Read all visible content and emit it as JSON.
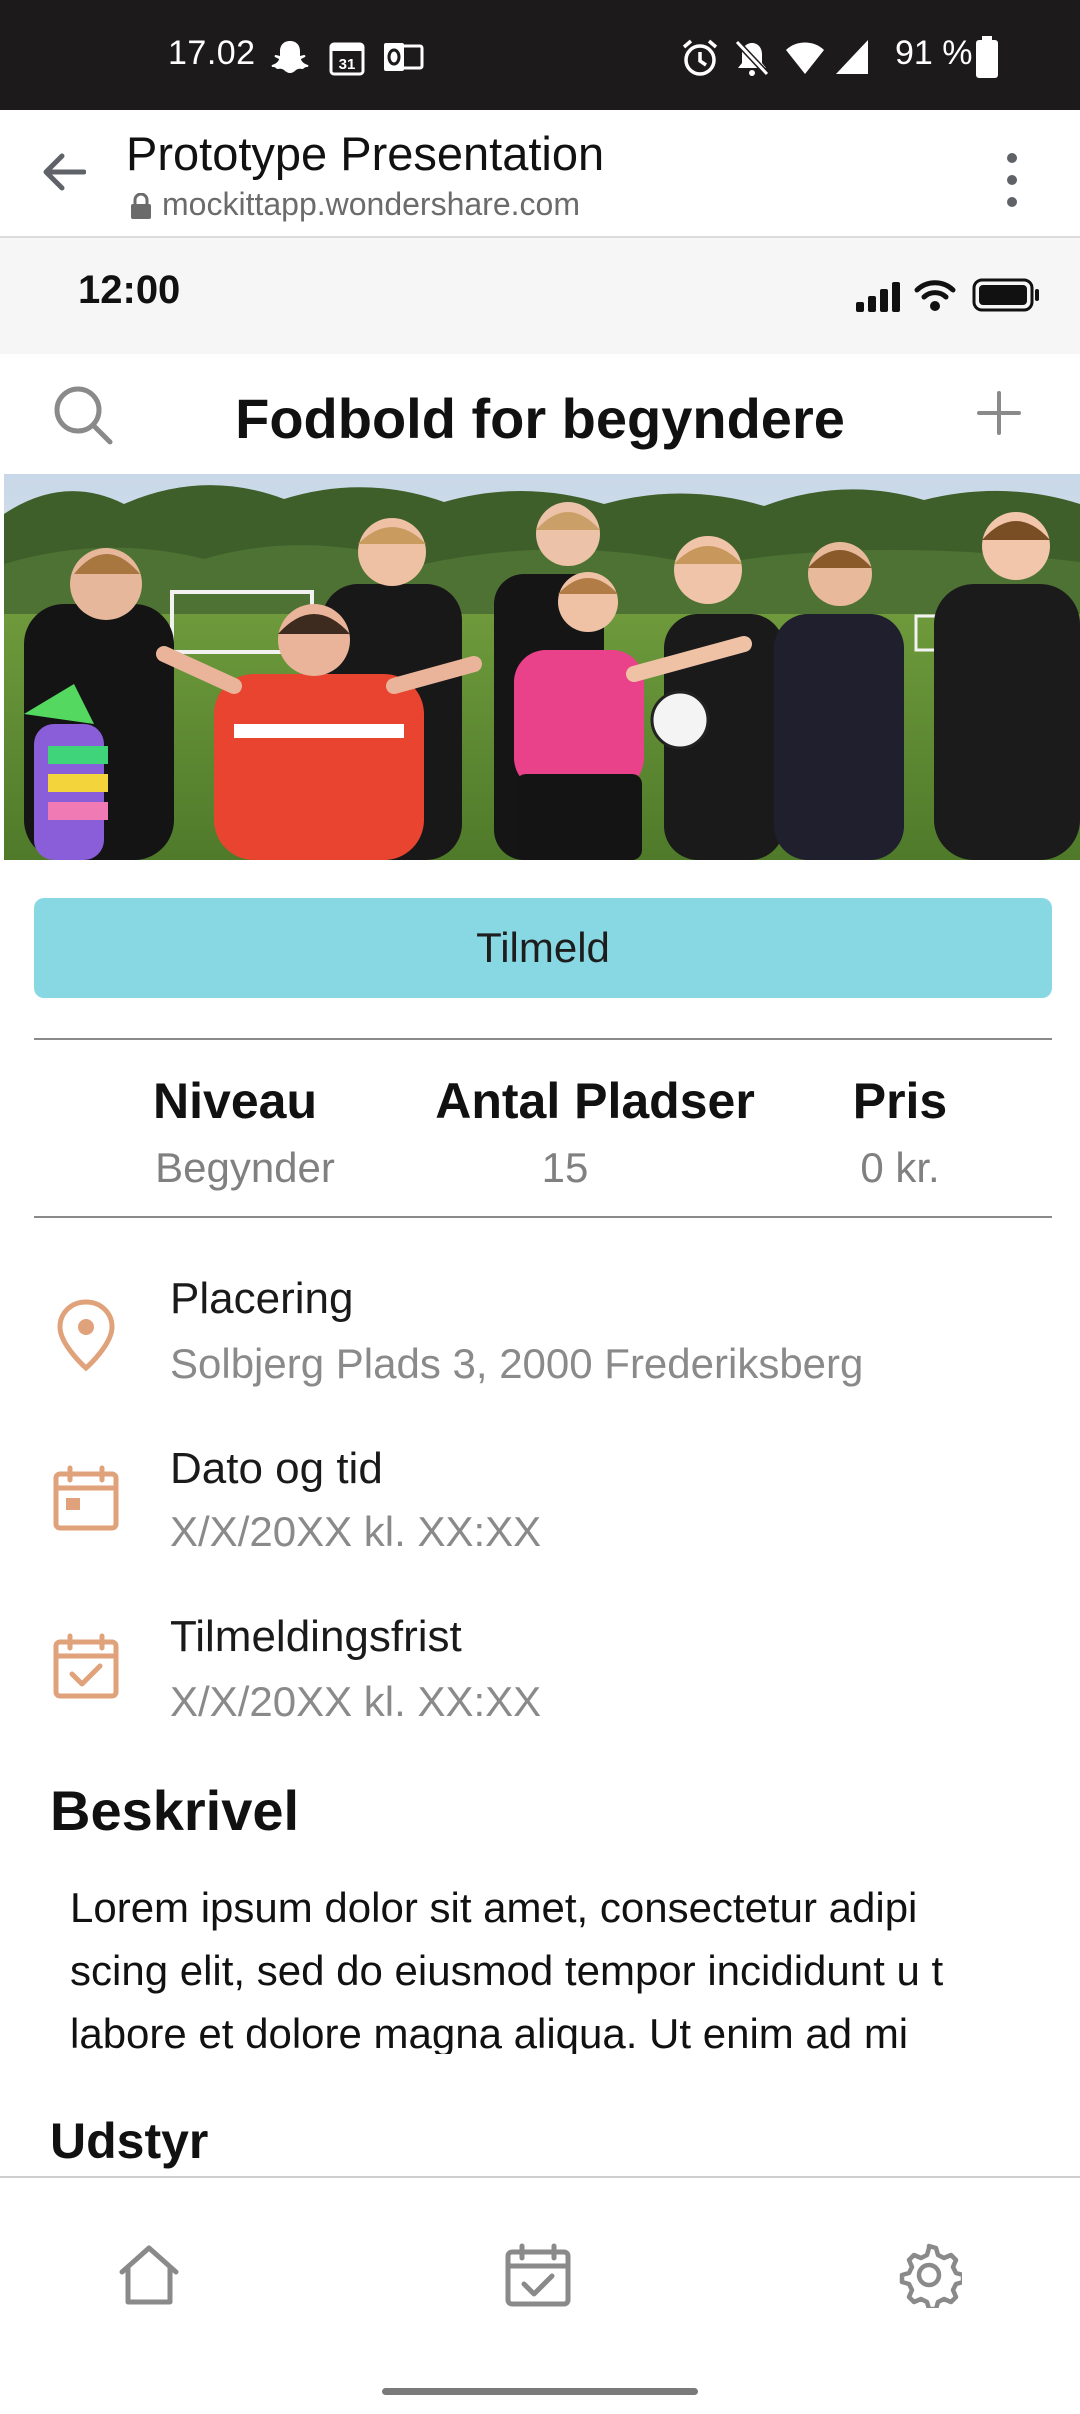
{
  "status_bar": {
    "time": "17.02",
    "calendar_day": "31",
    "battery_percent": "91 %",
    "icons": [
      "snapchat-icon",
      "calendar-icon",
      "outlook-icon",
      "alarm-icon",
      "mute-icon",
      "wifi-icon",
      "signal-icon",
      "battery-icon"
    ]
  },
  "browser": {
    "title": "Prototype Presentation",
    "url": "mockittapp.wondershare.com"
  },
  "proto_status": {
    "time": "12:00"
  },
  "header": {
    "title": "Fodbold for begyndere"
  },
  "signup_button": {
    "label": "Tilmeld"
  },
  "stats": [
    {
      "label": "Niveau",
      "value": "Begynder"
    },
    {
      "label": "Antal Pladser",
      "value": "15"
    },
    {
      "label": "Pris",
      "value": "0 kr."
    }
  ],
  "info": {
    "location": {
      "label": "Placering",
      "value": "Solbjerg Plads 3, 2000 Frederiksberg"
    },
    "datetime": {
      "label": "Dato og tid",
      "value": "X/X/20XX kl. XX:XX"
    },
    "deadline": {
      "label": "Tilmeldingsfrist",
      "value": "X/X/20XX kl. XX:XX"
    }
  },
  "description": {
    "heading": "Beskrivel",
    "body": "Lorem ipsum dolor sit amet, consectetur adipi scing elit, sed do eiusmod tempor incididunt u t labore et dolore magna aliqua. Ut enim ad mi"
  },
  "equipment": {
    "heading": "Udstyr"
  },
  "colors": {
    "accent": "#87d8e3",
    "icon_orange": "#e0a27b",
    "status_bar": "#1c1a1a"
  }
}
